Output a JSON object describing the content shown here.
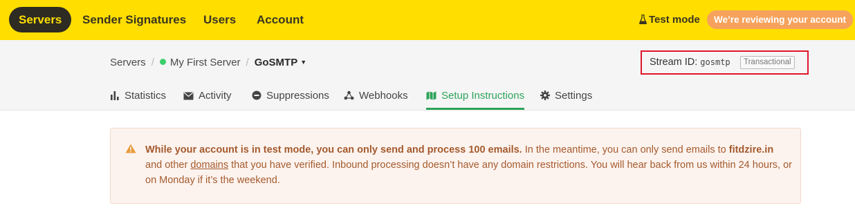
{
  "nav": {
    "active": "Servers",
    "links": [
      "Sender Signatures",
      "Users",
      "Account"
    ],
    "test_mode": "Test mode",
    "review_badge": "We’re reviewing your account"
  },
  "breadcrumb": {
    "root": "Servers",
    "server": "My First Server",
    "current": "GoSMTP"
  },
  "stream": {
    "label": "Stream ID:",
    "id": "gosmtp",
    "type": "Transactional"
  },
  "tabs": [
    {
      "label": "Statistics",
      "icon": "bar-chart-icon"
    },
    {
      "label": "Activity",
      "icon": "envelope-icon"
    },
    {
      "label": "Suppressions",
      "icon": "minus-circle-icon"
    },
    {
      "label": "Webhooks",
      "icon": "webhook-icon"
    },
    {
      "label": "Setup Instructions",
      "icon": "map-icon",
      "active": true
    },
    {
      "label": "Settings",
      "icon": "gear-icon"
    }
  ],
  "alert": {
    "bold": "While your account is in test mode, you can only send and process 100 emails.",
    "text1": " In the meantime, you can only send emails to ",
    "domain": "fitdzire.in",
    "text2": "and other ",
    "link": "domains",
    "text3": " that you have verified. Inbound processing doesn’t have any domain restrictions. You will hear back from us within 24 hours, or on Monday if it’s the weekend."
  },
  "colors": {
    "topbar": "#ffde00",
    "active_tab": "#2ea35a",
    "alert_text": "#a35a2e",
    "highlight_box": "#e0162b"
  }
}
